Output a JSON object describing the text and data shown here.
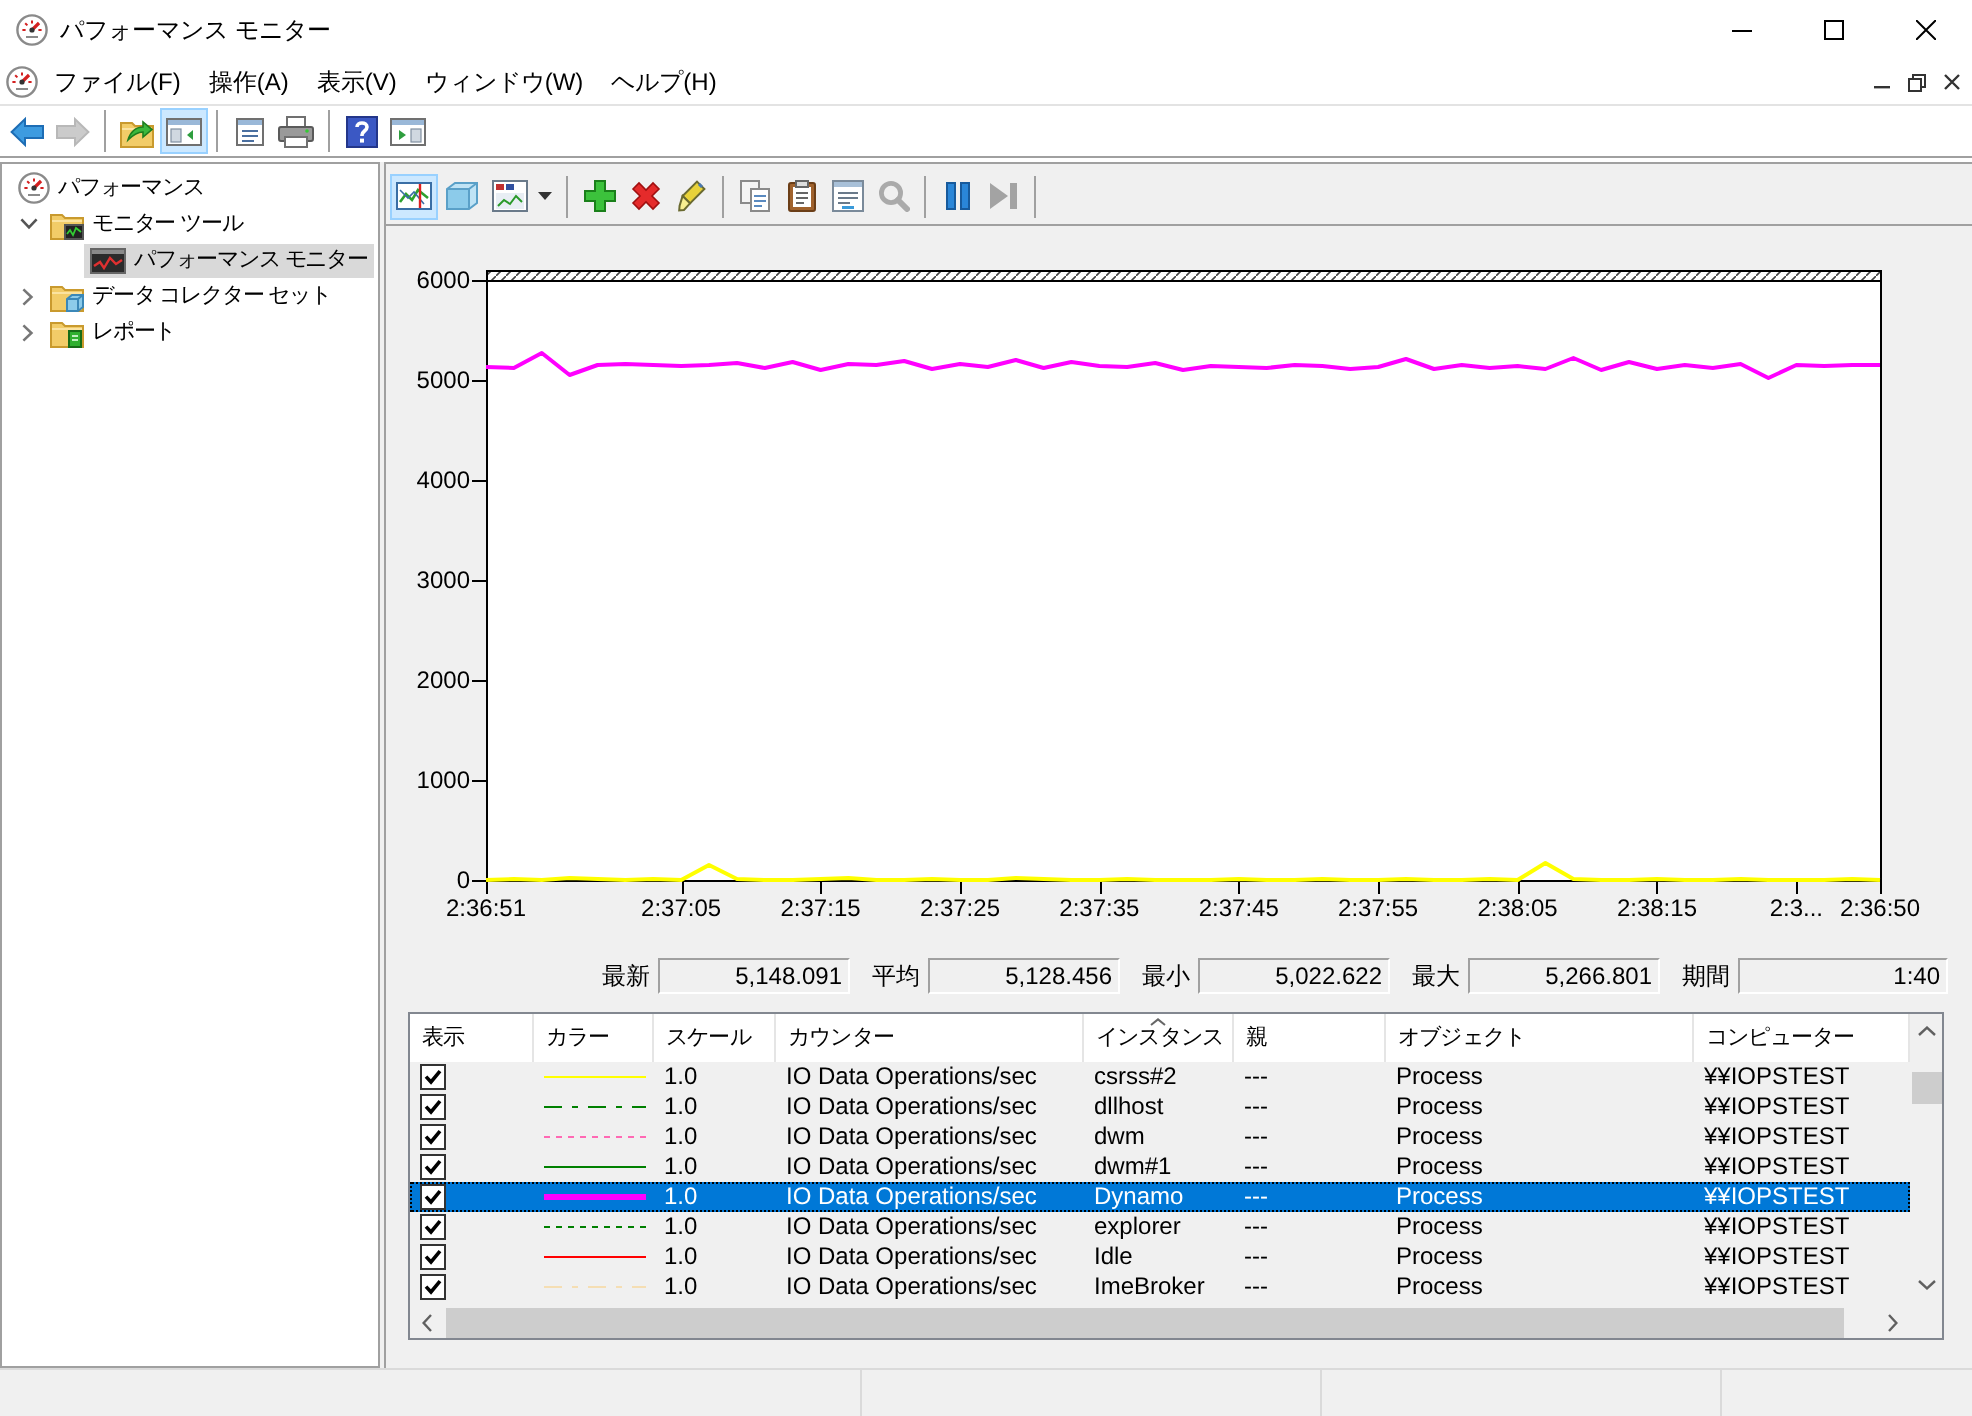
{
  "window": {
    "title": "パフォーマンス モニター"
  },
  "menu_bar": {
    "items": [
      {
        "label": "ファイル(F)"
      },
      {
        "label": "操作(A)"
      },
      {
        "label": "表示(V)"
      },
      {
        "label": "ウィンドウ(W)"
      },
      {
        "label": "ヘルプ(H)"
      }
    ]
  },
  "toolbar": [
    {
      "kind": "back",
      "selected": false,
      "disabled": false
    },
    {
      "kind": "forward",
      "selected": false,
      "disabled": true
    },
    {
      "kind": "separator"
    },
    {
      "kind": "up",
      "selected": false,
      "disabled": false
    },
    {
      "kind": "tree",
      "selected": true,
      "disabled": false
    },
    {
      "kind": "separator"
    },
    {
      "kind": "properties",
      "selected": false,
      "disabled": false
    },
    {
      "kind": "print",
      "selected": false,
      "disabled": false
    },
    {
      "kind": "separator"
    },
    {
      "kind": "help",
      "selected": false,
      "disabled": false
    },
    {
      "kind": "actions",
      "selected": false,
      "disabled": false
    }
  ],
  "sidebar": {
    "tree": [
      {
        "kind": "root",
        "label": "パフォーマンス",
        "selected": false,
        "children": [
          {
            "kind": "tools",
            "label": "モニター ツール",
            "expanded": true,
            "selected": false,
            "children": [
              {
                "kind": "monitor",
                "label": "パフォーマンス モニター",
                "selected": true
              }
            ]
          },
          {
            "kind": "collector",
            "label": "データ コレクター セット",
            "expanded": false,
            "selected": false
          },
          {
            "kind": "reports",
            "label": "レポート",
            "expanded": false,
            "selected": false
          }
        ]
      }
    ]
  },
  "chart_toolbar": [
    {
      "kind": "current",
      "selected": true,
      "disabled": false
    },
    {
      "kind": "log",
      "selected": false,
      "disabled": false
    },
    {
      "kind": "graph_type",
      "selected": false,
      "disabled": false
    },
    {
      "kind": "separator"
    },
    {
      "kind": "add",
      "selected": false,
      "disabled": false
    },
    {
      "kind": "delete",
      "selected": false,
      "disabled": false
    },
    {
      "kind": "highlight",
      "selected": false,
      "disabled": false
    },
    {
      "kind": "separator"
    },
    {
      "kind": "copy",
      "selected": false,
      "disabled": false
    },
    {
      "kind": "paste",
      "selected": false,
      "disabled": false
    },
    {
      "kind": "properties",
      "selected": false,
      "disabled": false
    },
    {
      "kind": "zoom",
      "selected": false,
      "disabled": true
    },
    {
      "kind": "separator"
    },
    {
      "kind": "freeze",
      "selected": false,
      "disabled": false
    },
    {
      "kind": "update",
      "selected": false,
      "disabled": true
    },
    {
      "kind": "separator"
    }
  ],
  "graph": {
    "chart_data": {
      "type": "line",
      "categories": [
        "2:36:51",
        null,
        null,
        null,
        null,
        null,
        null,
        "2:37:05",
        null,
        null,
        null,
        null,
        "2:37:15",
        null,
        null,
        null,
        null,
        "2:37:25",
        null,
        null,
        null,
        null,
        "2:37:35",
        null,
        null,
        null,
        null,
        "2:37:45",
        null,
        null,
        null,
        null,
        "2:37:55",
        null,
        null,
        null,
        null,
        "2:38:05",
        null,
        null,
        null,
        null,
        "2:38:15",
        null,
        null,
        null,
        null,
        "2:3...",
        null,
        null,
        "2:36:50"
      ],
      "ylim": [
        0,
        6000
      ],
      "yticks": [
        0,
        1000,
        2000,
        3000,
        4000,
        5000,
        6000
      ],
      "series": [
        {
          "color": "#ff00ff",
          "values": [
            5130,
            5120,
            5270,
            5050,
            5150,
            5160,
            5150,
            5140,
            5150,
            5170,
            5120,
            5180,
            5100,
            5160,
            5150,
            5190,
            5110,
            5160,
            5130,
            5200,
            5120,
            5180,
            5140,
            5130,
            5170,
            5100,
            5140,
            5130,
            5120,
            5150,
            5140,
            5110,
            5130,
            5210,
            5110,
            5150,
            5120,
            5140,
            5110,
            5220,
            5100,
            5180,
            5110,
            5150,
            5120,
            5160,
            5020,
            5150,
            5140,
            5150,
            5150
          ]
        },
        {
          "color": "#ffff00",
          "values": [
            0,
            10,
            0,
            20,
            10,
            0,
            10,
            0,
            150,
            10,
            0,
            0,
            10,
            20,
            0,
            0,
            10,
            0,
            0,
            20,
            10,
            0,
            0,
            10,
            0,
            0,
            0,
            10,
            0,
            0,
            10,
            0,
            0,
            10,
            0,
            0,
            10,
            0,
            170,
            10,
            0,
            0,
            10,
            0,
            0,
            10,
            0,
            0,
            0,
            10,
            0
          ]
        }
      ]
    }
  },
  "stats": [
    {
      "label": "最新",
      "value": "5,148.091"
    },
    {
      "label": "平均",
      "value": "5,128.456"
    },
    {
      "label": "最小",
      "value": "5,022.622"
    },
    {
      "label": "最大",
      "value": "5,266.801"
    },
    {
      "label": "期間",
      "value": "1:40"
    }
  ],
  "counter_table": {
    "columns": [
      {
        "label": "表示",
        "sorted": false
      },
      {
        "label": "カラー",
        "sorted": false
      },
      {
        "label": "スケール",
        "sorted": false
      },
      {
        "label": "カウンター",
        "sorted": false
      },
      {
        "label": "インスタンス",
        "sorted": true
      },
      {
        "label": "親",
        "sorted": false
      },
      {
        "label": "オブジェクト",
        "sorted": false
      },
      {
        "label": "コンピューター",
        "sorted": false
      }
    ],
    "rows": [
      {
        "checked": true,
        "color": "#ffff00",
        "kind": "solid",
        "scale": "1.0",
        "counter": "IO Data Operations/sec",
        "instance": "csrss#2",
        "parent": "---",
        "object": "Process",
        "computer": "¥¥IOPSTEST",
        "selected": false
      },
      {
        "checked": true,
        "color": "#008000",
        "kind": "dashdot",
        "scale": "1.0",
        "counter": "IO Data Operations/sec",
        "instance": "dllhost",
        "parent": "---",
        "object": "Process",
        "computer": "¥¥IOPSTEST",
        "selected": false
      },
      {
        "checked": true,
        "color": "#ff69b4",
        "kind": "dotted",
        "scale": "1.0",
        "counter": "IO Data Operations/sec",
        "instance": "dwm",
        "parent": "---",
        "object": "Process",
        "computer": "¥¥IOPSTEST",
        "selected": false
      },
      {
        "checked": true,
        "color": "#008000",
        "kind": "solid",
        "scale": "1.0",
        "counter": "IO Data Operations/sec",
        "instance": "dwm#1",
        "parent": "---",
        "object": "Process",
        "computer": "¥¥IOPSTEST",
        "selected": false
      },
      {
        "checked": true,
        "color": "#ff00ff",
        "kind": "thick",
        "scale": "1.0",
        "counter": "IO Data Operations/sec",
        "instance": "Dynamo",
        "parent": "---",
        "object": "Process",
        "computer": "¥¥IOPSTEST",
        "selected": true
      },
      {
        "checked": true,
        "color": "#008000",
        "kind": "dotted",
        "scale": "1.0",
        "counter": "IO Data Operations/sec",
        "instance": "explorer",
        "parent": "---",
        "object": "Process",
        "computer": "¥¥IOPSTEST",
        "selected": false
      },
      {
        "checked": true,
        "color": "#ff0000",
        "kind": "solid",
        "scale": "1.0",
        "counter": "IO Data Operations/sec",
        "instance": "Idle",
        "parent": "---",
        "object": "Process",
        "computer": "¥¥IOPSTEST",
        "selected": false
      },
      {
        "checked": true,
        "color": "#f5deb3",
        "kind": "dashdot",
        "scale": "1.0",
        "counter": "IO Data Operations/sec",
        "instance": "ImeBroker",
        "parent": "---",
        "object": "Process",
        "computer": "¥¥IOPSTEST",
        "selected": false
      }
    ]
  }
}
